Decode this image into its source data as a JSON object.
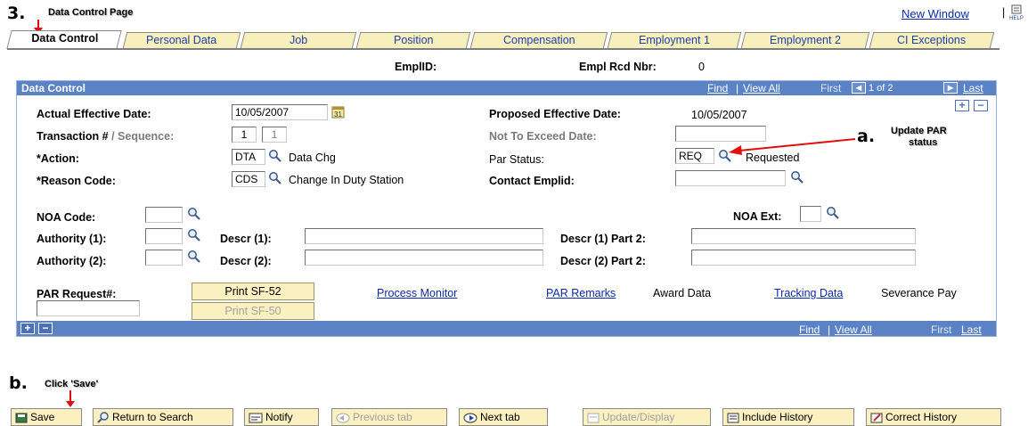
{
  "annotations": {
    "step3_number": "3.",
    "step3_text": "Data Control Page",
    "a_letter": "a.",
    "a_text_line1": "Update PAR",
    "a_text_line2": "status",
    "b_letter": "b.",
    "b_text": "Click 'Save'",
    "arrow_color": "#e01010"
  },
  "top_right": {
    "new_window": "New Window",
    "separator": "|"
  },
  "tabs": [
    {
      "label": "Data Control",
      "active": true
    },
    {
      "label": "Personal Data"
    },
    {
      "label": "Job"
    },
    {
      "label": "Position"
    },
    {
      "label": "Compensation"
    },
    {
      "label": "Employment 1"
    },
    {
      "label": "Employment 2"
    },
    {
      "label": "CI Exceptions"
    }
  ],
  "empl": {
    "emplid_label": "EmplID:",
    "rcd_label": "Empl Rcd Nbr:",
    "rcd_value": "0"
  },
  "panel": {
    "title": "Data Control",
    "find": "Find",
    "sep": "|",
    "view_all": "View All",
    "first": "First",
    "count": "1 of 2",
    "last": "Last",
    "add_symbol": "+",
    "remove_symbol": "−",
    "header_color": "#5c82c6"
  },
  "form": {
    "actual_effective_date_label": "Actual Effective Date:",
    "actual_effective_date": "10/05/2007",
    "proposed_effective_date_label": "Proposed Effective Date:",
    "proposed_effective_date": "10/05/2007",
    "transaction_label": "Transaction #",
    "sequence_label": "/ Sequence:",
    "transaction_value": "1",
    "sequence_value": "1",
    "not_to_exceed_label": "Not To Exceed Date:",
    "action_label": "*Action:",
    "action_code": "DTA",
    "action_descr": "Data Chg",
    "par_status_label": "Par Status:",
    "par_status_code": "REQ",
    "par_status_descr": "Requested",
    "reason_label": "*Reason Code:",
    "reason_code": "CDS",
    "reason_descr": "Change In Duty Station",
    "contact_emplid_label": "Contact Emplid:",
    "noa_code_label": "NOA Code:",
    "noa_ext_label": "NOA Ext:",
    "authority1_label": "Authority (1):",
    "descr1_label": "Descr (1):",
    "descr1_part2_label": "Descr (1) Part 2:",
    "authority2_label": "Authority (2):",
    "descr2_label": "Descr (2):",
    "descr2_part2_label": "Descr (2) Part 2:",
    "par_request_label": "PAR Request#:",
    "print_sf52": "Print SF-52",
    "print_sf50": "Print SF-50",
    "process_monitor": "Process Monitor",
    "par_remarks": "PAR Remarks",
    "award_data": "Award Data",
    "tracking_data": "Tracking Data",
    "severance_pay": "Severance Pay"
  },
  "toolbar": {
    "save": "Save",
    "return_to_search": "Return to Search",
    "notify": "Notify",
    "previous_tab": "Previous tab",
    "next_tab": "Next tab",
    "update_display": "Update/Display",
    "include_history": "Include History",
    "correct_history": "Correct History"
  }
}
